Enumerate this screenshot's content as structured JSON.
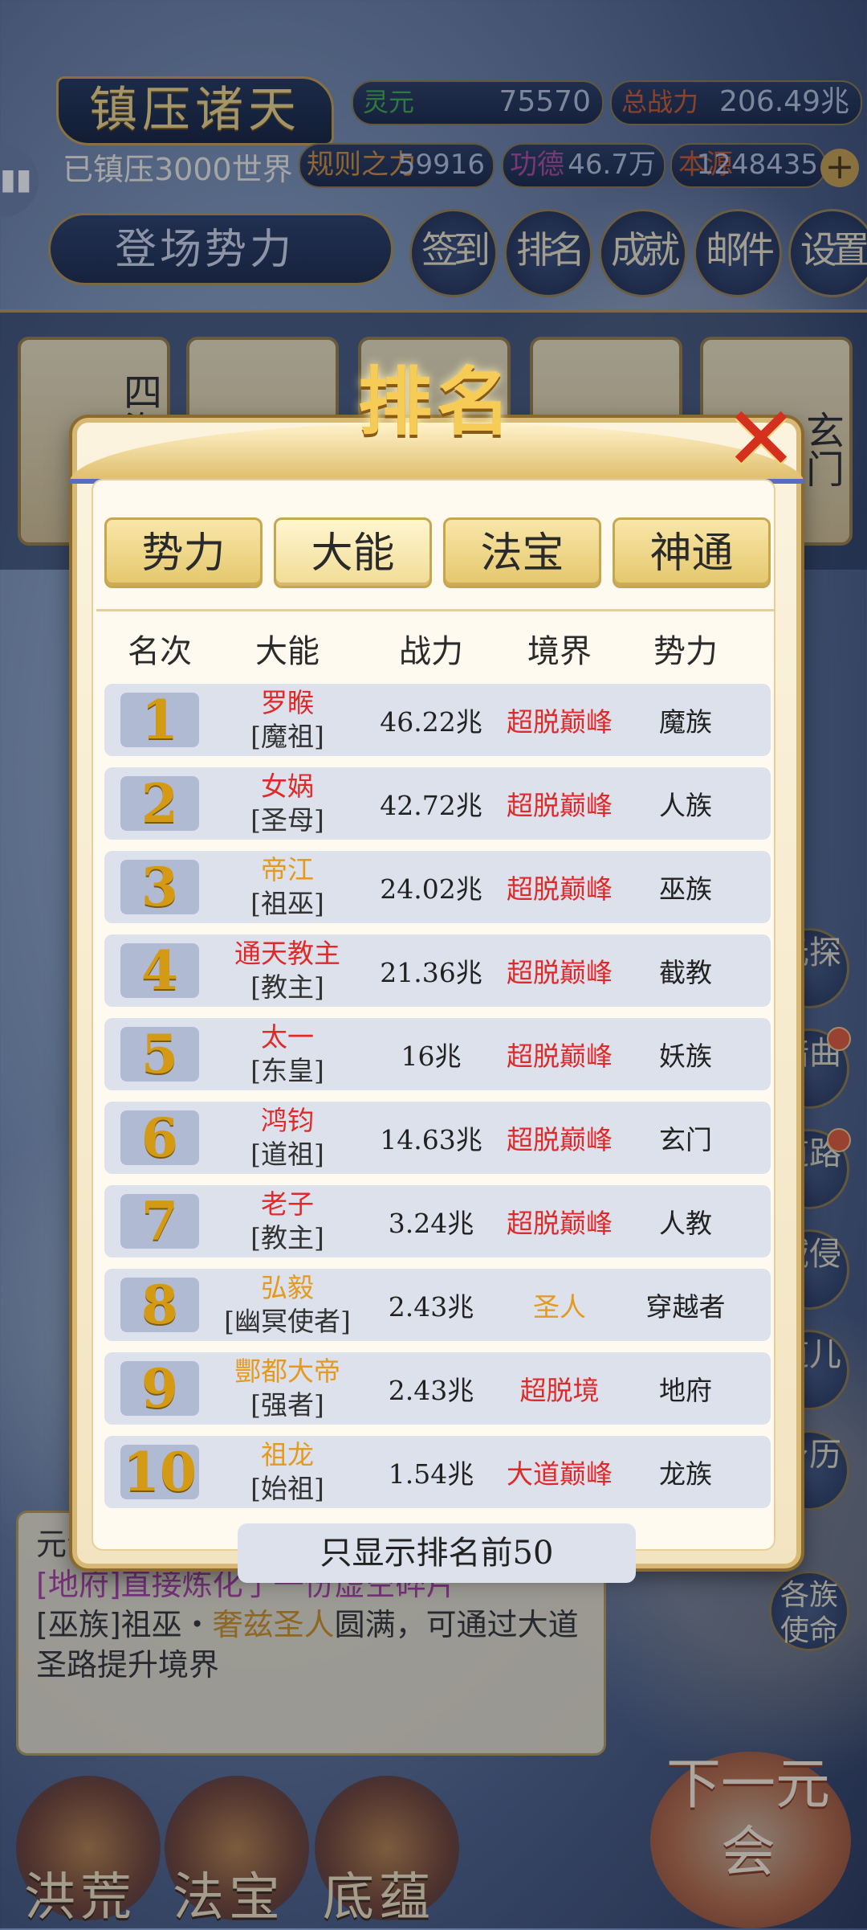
{
  "hud": {
    "title": "镇压诸天",
    "suppressed": "已镇压3000世界",
    "lingyuan_label": "灵元",
    "lingyuan_value": "75570",
    "total_power_label": "总战力",
    "total_power_value": "206.49兆",
    "rule_label": "规则之力",
    "rule_value": "59916",
    "merit_label": "功德",
    "merit_value": "46.7万",
    "origin_label": "本源",
    "origin_value": "1248435",
    "stage_button": "登场势力",
    "menu": [
      "签到",
      "排名",
      "成就",
      "邮件",
      "设置"
    ]
  },
  "cards": [
    "四海汪洋",
    "玄门"
  ],
  "side_menu": [
    "元探",
    "暗曲",
    "道路",
    "域侵",
    "道儿",
    "身历",
    "各族使命"
  ],
  "log": {
    "line1": "元会",
    "line2": "[地府]直接炼化了一份虚空碎片",
    "line3_pre": "[巫族]祖巫・",
    "line3_hl": "奢兹圣人",
    "line3_post": "圆满，可通过大道圣路提升境界"
  },
  "bottom_nav": [
    "洪荒",
    "法宝",
    "底蕴"
  ],
  "next_button": "下一元会",
  "modal": {
    "title": "排名",
    "close": "✕",
    "tabs": [
      "势力",
      "大能",
      "法宝",
      "神通"
    ],
    "active_tab": "大能",
    "columns": [
      "名次",
      "大能",
      "战力",
      "境界",
      "势力"
    ],
    "footer": "只显示排名前50",
    "rows": [
      {
        "rank": "1",
        "name": "罗睺",
        "title": "[魔祖]",
        "power": "46.22兆",
        "realm": "超脱巅峰",
        "faction": "魔族",
        "name_color": "#e02a2a",
        "realm_color": "#e02a2a"
      },
      {
        "rank": "2",
        "name": "女娲",
        "title": "[圣母]",
        "power": "42.72兆",
        "realm": "超脱巅峰",
        "faction": "人族",
        "name_color": "#e02a2a",
        "realm_color": "#e02a2a"
      },
      {
        "rank": "3",
        "name": "帝江",
        "title": "[祖巫]",
        "power": "24.02兆",
        "realm": "超脱巅峰",
        "faction": "巫族",
        "name_color": "#e49a1f",
        "realm_color": "#e02a2a"
      },
      {
        "rank": "4",
        "name": "通天教主",
        "title": "[教主]",
        "power": "21.36兆",
        "realm": "超脱巅峰",
        "faction": "截教",
        "name_color": "#e02a2a",
        "realm_color": "#e02a2a"
      },
      {
        "rank": "5",
        "name": "太一",
        "title": "[东皇]",
        "power": "16兆",
        "realm": "超脱巅峰",
        "faction": "妖族",
        "name_color": "#e02a2a",
        "realm_color": "#e02a2a"
      },
      {
        "rank": "6",
        "name": "鸿钧",
        "title": "[道祖]",
        "power": "14.63兆",
        "realm": "超脱巅峰",
        "faction": "玄门",
        "name_color": "#e02a2a",
        "realm_color": "#e02a2a"
      },
      {
        "rank": "7",
        "name": "老子",
        "title": "[教主]",
        "power": "3.24兆",
        "realm": "超脱巅峰",
        "faction": "人教",
        "name_color": "#e02a2a",
        "realm_color": "#e02a2a"
      },
      {
        "rank": "8",
        "name": "弘毅",
        "title": "[幽冥使者]",
        "power": "2.43兆",
        "realm": "圣人",
        "faction": "穿越者",
        "name_color": "#e49a1f",
        "realm_color": "#e49a1f"
      },
      {
        "rank": "9",
        "name": "酆都大帝",
        "title": "[强者]",
        "power": "2.43兆",
        "realm": "超脱境",
        "faction": "地府",
        "name_color": "#e49a1f",
        "realm_color": "#e02a2a"
      },
      {
        "rank": "10",
        "name": "祖龙",
        "title": "[始祖]",
        "power": "1.54兆",
        "realm": "大道巅峰",
        "faction": "龙族",
        "name_color": "#e49a1f",
        "realm_color": "#e02a2a"
      }
    ]
  }
}
